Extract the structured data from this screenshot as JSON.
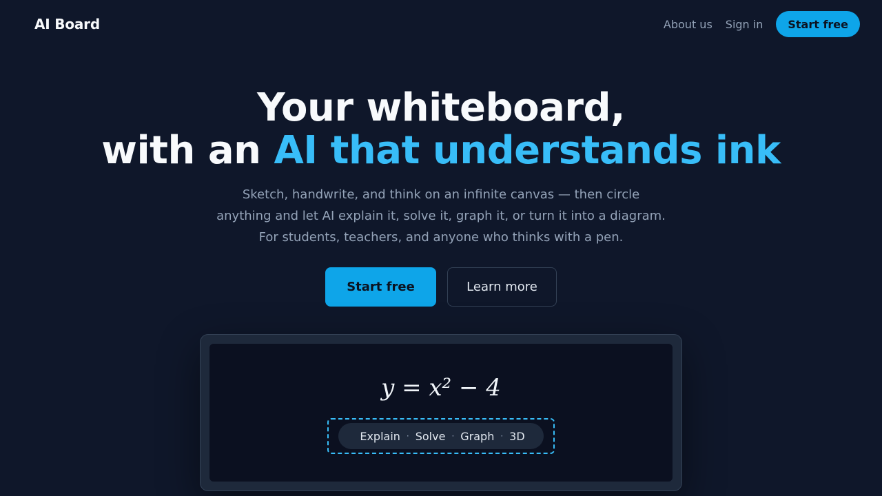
{
  "nav": {
    "brand": "AI Board",
    "links": [
      "About us",
      "Sign in"
    ],
    "cta": "Start free"
  },
  "hero": {
    "title_line1": "Your whiteboard,",
    "title_line2_prefix": "with an ",
    "title_line2_accent": "AI that understands ink",
    "subtitle_lines": [
      "Sketch, handwrite, and think on an infinite canvas — then circle",
      "anything and let AI explain it, solve it, graph it, or turn it into a diagram.",
      "For students, teachers, and anyone who thinks with a pen."
    ],
    "primary_cta": "Start free",
    "secondary_cta": "Learn more"
  },
  "board": {
    "equation": "y = x² − 4",
    "actions": [
      "Explain",
      "Solve",
      "Graph",
      "3D"
    ],
    "separator": "·"
  },
  "colors": {
    "background": "#0f172a",
    "accent": "#0ea5e9",
    "accent_text": "#38bdf8"
  }
}
